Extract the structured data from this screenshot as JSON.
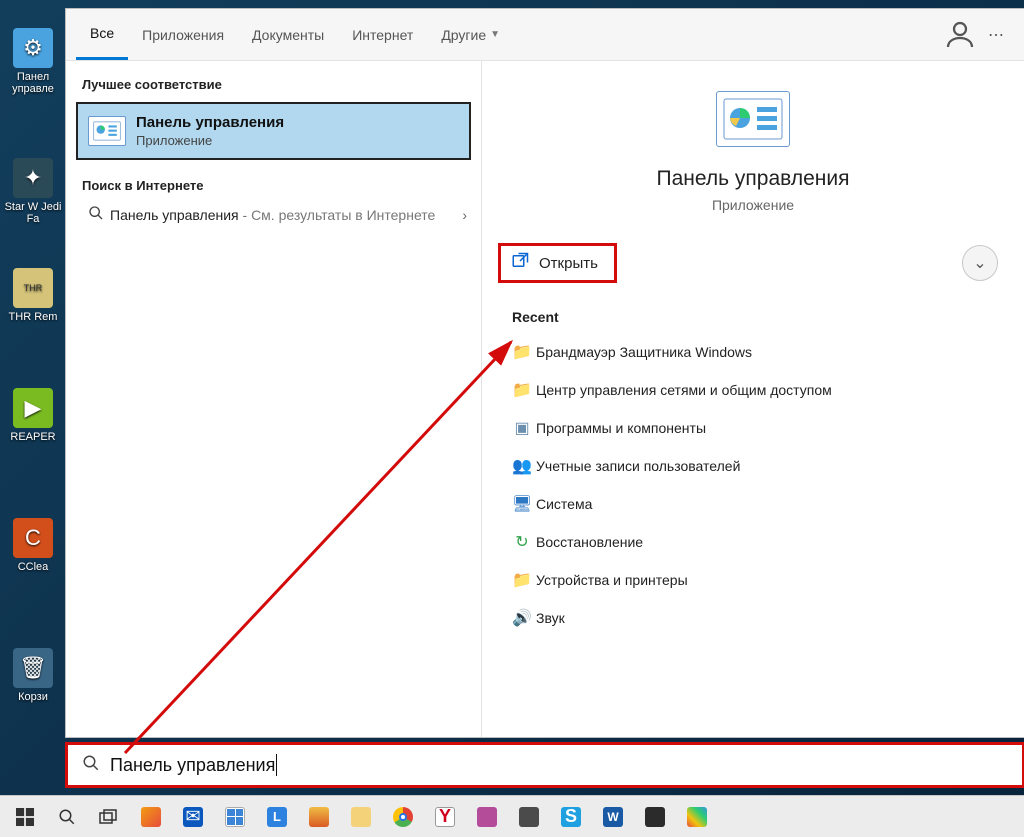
{
  "desktop_icons": [
    {
      "label": "Панел управле"
    },
    {
      "label": "Star W Jedi Fa"
    },
    {
      "label": "THR Rem"
    },
    {
      "label": "REAPER"
    },
    {
      "label": "CClea"
    },
    {
      "label": "Корзи"
    }
  ],
  "tabs": {
    "all": "Все",
    "apps": "Приложения",
    "docs": "Документы",
    "web": "Интернет",
    "more": "Другие"
  },
  "sections": {
    "best": "Лучшее соответствие",
    "web": "Поиск в Интернете",
    "recent": "Recent"
  },
  "best_match": {
    "title": "Панель управления",
    "subtitle": "Приложение"
  },
  "web_result": {
    "title": "Панель управления",
    "suffix": " - См. результаты в Интернете"
  },
  "preview": {
    "title": "Панель управления",
    "subtitle": "Приложение",
    "open": "Открыть"
  },
  "recent": [
    {
      "icon": "folder",
      "label": "Брандмауэр Защитника Windows"
    },
    {
      "icon": "folder",
      "label": "Центр управления сетями и общим доступом"
    },
    {
      "icon": "prog",
      "label": "Программы и компоненты"
    },
    {
      "icon": "users",
      "label": "Учетные записи пользователей"
    },
    {
      "icon": "sys",
      "label": "Система"
    },
    {
      "icon": "rec",
      "label": "Восстановление"
    },
    {
      "icon": "folder",
      "label": "Устройства и принтеры"
    },
    {
      "icon": "sound",
      "label": "Звук"
    }
  ],
  "search": {
    "value": "Панель управления"
  }
}
